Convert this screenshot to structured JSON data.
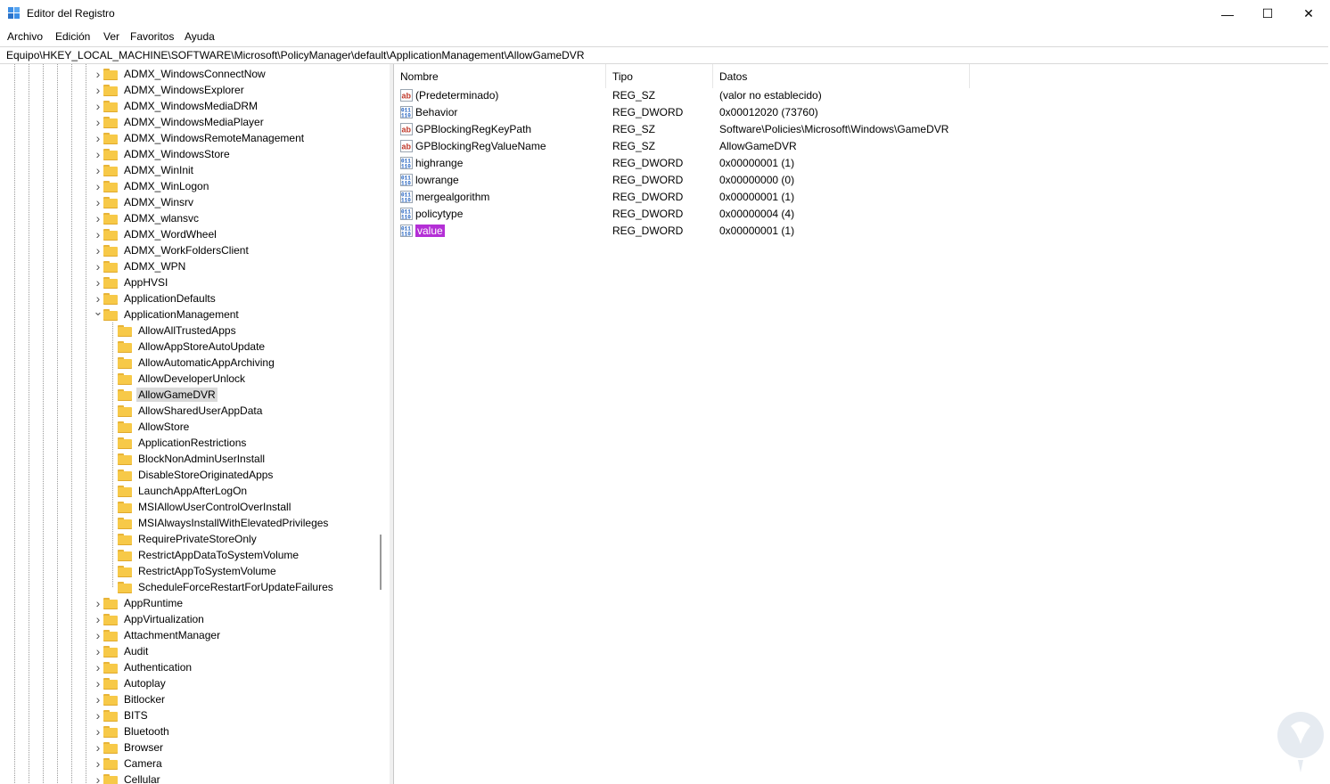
{
  "window": {
    "title": "Editor del Registro",
    "minimize_glyph": "—",
    "maximize_glyph": "☐",
    "close_glyph": "✕"
  },
  "menu": [
    "Archivo",
    "Edición",
    "Ver",
    "Favoritos",
    "Ayuda"
  ],
  "address": "Equipo\\HKEY_LOCAL_MACHINE\\SOFTWARE\\Microsoft\\PolicyManager\\default\\ApplicationManagement\\AllowGameDVR",
  "tree": [
    {
      "label": "ADMX_WindowsConnectNow",
      "level": 0,
      "expander": "collapsed"
    },
    {
      "label": "ADMX_WindowsExplorer",
      "level": 0,
      "expander": "collapsed"
    },
    {
      "label": "ADMX_WindowsMediaDRM",
      "level": 0,
      "expander": "collapsed"
    },
    {
      "label": "ADMX_WindowsMediaPlayer",
      "level": 0,
      "expander": "collapsed"
    },
    {
      "label": "ADMX_WindowsRemoteManagement",
      "level": 0,
      "expander": "collapsed"
    },
    {
      "label": "ADMX_WindowsStore",
      "level": 0,
      "expander": "collapsed"
    },
    {
      "label": "ADMX_WinInit",
      "level": 0,
      "expander": "collapsed"
    },
    {
      "label": "ADMX_WinLogon",
      "level": 0,
      "expander": "collapsed"
    },
    {
      "label": "ADMX_Winsrv",
      "level": 0,
      "expander": "collapsed"
    },
    {
      "label": "ADMX_wlansvc",
      "level": 0,
      "expander": "collapsed"
    },
    {
      "label": "ADMX_WordWheel",
      "level": 0,
      "expander": "collapsed"
    },
    {
      "label": "ADMX_WorkFoldersClient",
      "level": 0,
      "expander": "collapsed"
    },
    {
      "label": "ADMX_WPN",
      "level": 0,
      "expander": "collapsed"
    },
    {
      "label": "AppHVSI",
      "level": 0,
      "expander": "collapsed"
    },
    {
      "label": "ApplicationDefaults",
      "level": 0,
      "expander": "collapsed"
    },
    {
      "label": "ApplicationManagement",
      "level": 0,
      "expander": "expanded"
    },
    {
      "label": "AllowAllTrustedApps",
      "level": 1,
      "expander": "none"
    },
    {
      "label": "AllowAppStoreAutoUpdate",
      "level": 1,
      "expander": "none"
    },
    {
      "label": "AllowAutomaticAppArchiving",
      "level": 1,
      "expander": "none"
    },
    {
      "label": "AllowDeveloperUnlock",
      "level": 1,
      "expander": "none"
    },
    {
      "label": "AllowGameDVR",
      "level": 1,
      "expander": "none",
      "selected": true
    },
    {
      "label": "AllowSharedUserAppData",
      "level": 1,
      "expander": "none"
    },
    {
      "label": "AllowStore",
      "level": 1,
      "expander": "none"
    },
    {
      "label": "ApplicationRestrictions",
      "level": 1,
      "expander": "none"
    },
    {
      "label": "BlockNonAdminUserInstall",
      "level": 1,
      "expander": "none"
    },
    {
      "label": "DisableStoreOriginatedApps",
      "level": 1,
      "expander": "none"
    },
    {
      "label": "LaunchAppAfterLogOn",
      "level": 1,
      "expander": "none"
    },
    {
      "label": "MSIAllowUserControlOverInstall",
      "level": 1,
      "expander": "none"
    },
    {
      "label": "MSIAlwaysInstallWithElevatedPrivileges",
      "level": 1,
      "expander": "none"
    },
    {
      "label": "RequirePrivateStoreOnly",
      "level": 1,
      "expander": "none"
    },
    {
      "label": "RestrictAppDataToSystemVolume",
      "level": 1,
      "expander": "none"
    },
    {
      "label": "RestrictAppToSystemVolume",
      "level": 1,
      "expander": "none"
    },
    {
      "label": "ScheduleForceRestartForUpdateFailures",
      "level": 1,
      "expander": "none"
    },
    {
      "label": "AppRuntime",
      "level": 0,
      "expander": "collapsed"
    },
    {
      "label": "AppVirtualization",
      "level": 0,
      "expander": "collapsed"
    },
    {
      "label": "AttachmentManager",
      "level": 0,
      "expander": "collapsed"
    },
    {
      "label": "Audit",
      "level": 0,
      "expander": "collapsed"
    },
    {
      "label": "Authentication",
      "level": 0,
      "expander": "collapsed"
    },
    {
      "label": "Autoplay",
      "level": 0,
      "expander": "collapsed"
    },
    {
      "label": "Bitlocker",
      "level": 0,
      "expander": "collapsed"
    },
    {
      "label": "BITS",
      "level": 0,
      "expander": "collapsed"
    },
    {
      "label": "Bluetooth",
      "level": 0,
      "expander": "collapsed"
    },
    {
      "label": "Browser",
      "level": 0,
      "expander": "collapsed"
    },
    {
      "label": "Camera",
      "level": 0,
      "expander": "collapsed"
    },
    {
      "label": "Cellular",
      "level": 0,
      "expander": "collapsed"
    }
  ],
  "columns": [
    "Nombre",
    "Tipo",
    "Datos"
  ],
  "values": [
    {
      "name": "(Predeterminado)",
      "type": "REG_SZ",
      "data": "(valor no establecido)",
      "icon": "string-value-icon"
    },
    {
      "name": "Behavior",
      "type": "REG_DWORD",
      "data": "0x00012020 (73760)",
      "icon": "binary-value-icon"
    },
    {
      "name": "GPBlockingRegKeyPath",
      "type": "REG_SZ",
      "data": "Software\\Policies\\Microsoft\\Windows\\GameDVR",
      "icon": "string-value-icon"
    },
    {
      "name": "GPBlockingRegValueName",
      "type": "REG_SZ",
      "data": "AllowGameDVR",
      "icon": "string-value-icon"
    },
    {
      "name": "highrange",
      "type": "REG_DWORD",
      "data": "0x00000001 (1)",
      "icon": "binary-value-icon"
    },
    {
      "name": "lowrange",
      "type": "REG_DWORD",
      "data": "0x00000000 (0)",
      "icon": "binary-value-icon"
    },
    {
      "name": "mergealgorithm",
      "type": "REG_DWORD",
      "data": "0x00000001 (1)",
      "icon": "binary-value-icon"
    },
    {
      "name": "policytype",
      "type": "REG_DWORD",
      "data": "0x00000004 (4)",
      "icon": "binary-value-icon"
    },
    {
      "name": "value",
      "type": "REG_DWORD",
      "data": "0x00000001 (1)",
      "icon": "binary-value-icon",
      "selected": true
    }
  ],
  "colors": {
    "selection_rename": "#b42fd6",
    "tree_selection": "#d9d9d9",
    "folder": "#f7c948",
    "string_icon": "#c0392b",
    "binary_icon": "#1f5fbf"
  }
}
